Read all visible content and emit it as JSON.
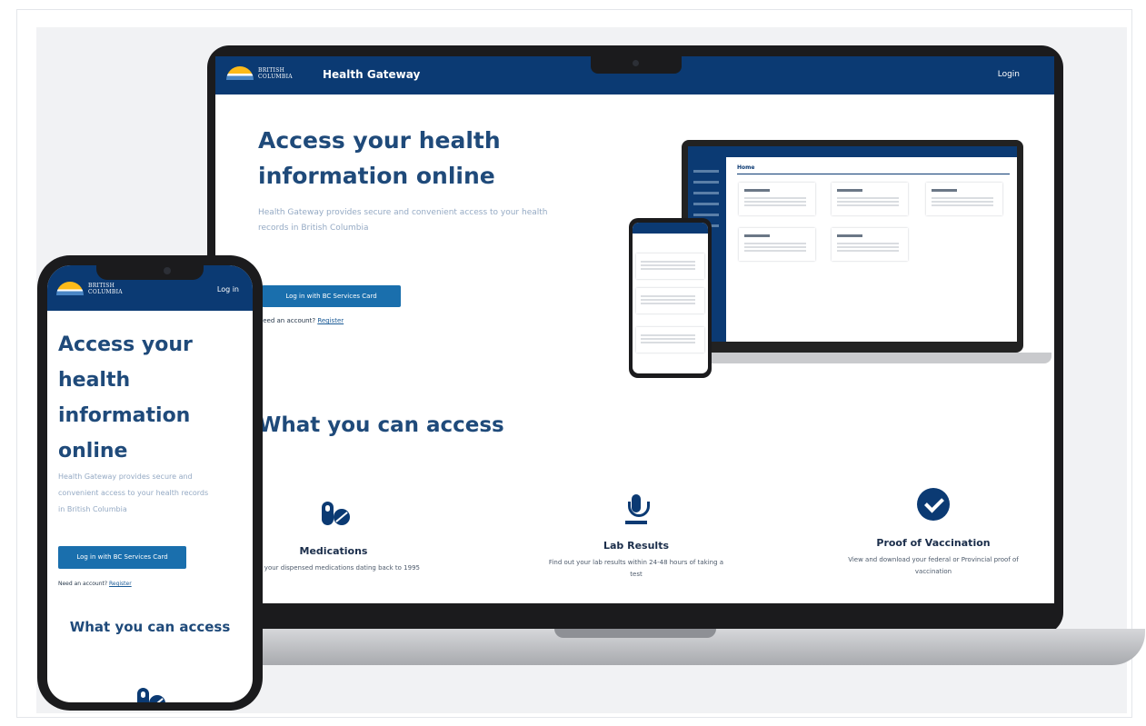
{
  "brand": {
    "logo_line1": "BRITISH",
    "logo_line2": "COLUMBIA",
    "app_name": "Health Gateway"
  },
  "header": {
    "title": "Health Gateway",
    "login_label": "Login"
  },
  "hero": {
    "title": "Access your health information online",
    "description": "Health Gateway provides secure and convenient access to your health records in British Columbia",
    "login_button": "Log in with BC Services Card",
    "need_account_text": "Need an account?",
    "register_link": "Register"
  },
  "access": {
    "heading": "What you can access",
    "features": [
      {
        "title": "Medications",
        "description": "View your dispensed medications dating back to 1995",
        "icon": "pills-icon"
      },
      {
        "title": "Lab Results",
        "description": "Find out your lab results within 24-48 hours of taking a test",
        "icon": "microscope-icon"
      },
      {
        "title": "Proof of Vaccination",
        "description": "View and download your federal or Provincial proof of vaccination",
        "icon": "check-circle-icon"
      }
    ]
  },
  "mobile": {
    "login_label": "Log in",
    "title": "Access your health information online",
    "description": "Health Gateway provides secure and convenient access to your health records in British Columbia",
    "login_button": "Log in with BC Services Card",
    "need_account_text": "Need an account?",
    "register_link": "Register",
    "access_heading": "What you can access"
  },
  "mini_app": {
    "home_label": "Home"
  },
  "colors": {
    "primary_navy": "#0b3a73",
    "button_blue": "#1a6fad",
    "heading_blue": "#1f4a7a",
    "bc_gold": "#fcba19"
  }
}
